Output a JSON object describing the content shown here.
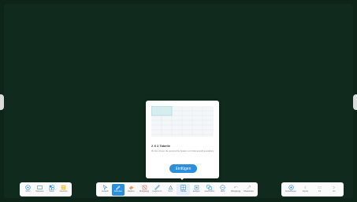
{
  "colors": {
    "board": "#112a1e",
    "accent": "#2b8fdc",
    "toolbar": "#fbfbfc"
  },
  "popover": {
    "size": "2 X 2 Tabelle",
    "description": "Mit dem Finger die gewünschte Spalten und Zeilenanzahl auswählen",
    "insert": "Einfügen"
  },
  "toolbar_left": [
    {
      "label": "Menü",
      "icon": "menu-icon"
    },
    {
      "label": "Dateiseite",
      "icon": "page-icon"
    },
    {
      "label": "Seiten",
      "icon": "pages-icon"
    },
    {
      "label": "Übersicht",
      "icon": "overview-icon"
    }
  ],
  "toolbar_mid": [
    {
      "label": "Auswahl",
      "icon": "select-icon"
    },
    {
      "label": "Schreiben",
      "icon": "pen-icon"
    },
    {
      "label": "Radierer",
      "icon": "eraser-icon"
    },
    {
      "label": "Rückgängig",
      "icon": "undo-icon"
    },
    {
      "label": "Lineal & Co.",
      "icon": "ruler-icon"
    },
    {
      "label": "Form",
      "icon": "shape-icon"
    },
    {
      "label": "Tabelle",
      "icon": "table-icon"
    },
    {
      "label": "Einfügen",
      "icon": "insert-icon"
    },
    {
      "label": "Anschreiben",
      "icon": "clip-icon"
    },
    {
      "label": "Mehr",
      "icon": "more-icon"
    },
    {
      "label": "Rückgängig",
      "icon": "undo2-icon"
    },
    {
      "label": "Wiederholen",
      "icon": "redo-icon"
    }
  ],
  "toolbar_right": [
    {
      "label": "Einstellungen",
      "icon": "settings-icon"
    },
    {
      "label": "Zurück",
      "icon": "prev-icon"
    },
    {
      "label": "1/1",
      "icon": "page-number"
    },
    {
      "label": "Vor",
      "icon": "next-icon"
    }
  ]
}
